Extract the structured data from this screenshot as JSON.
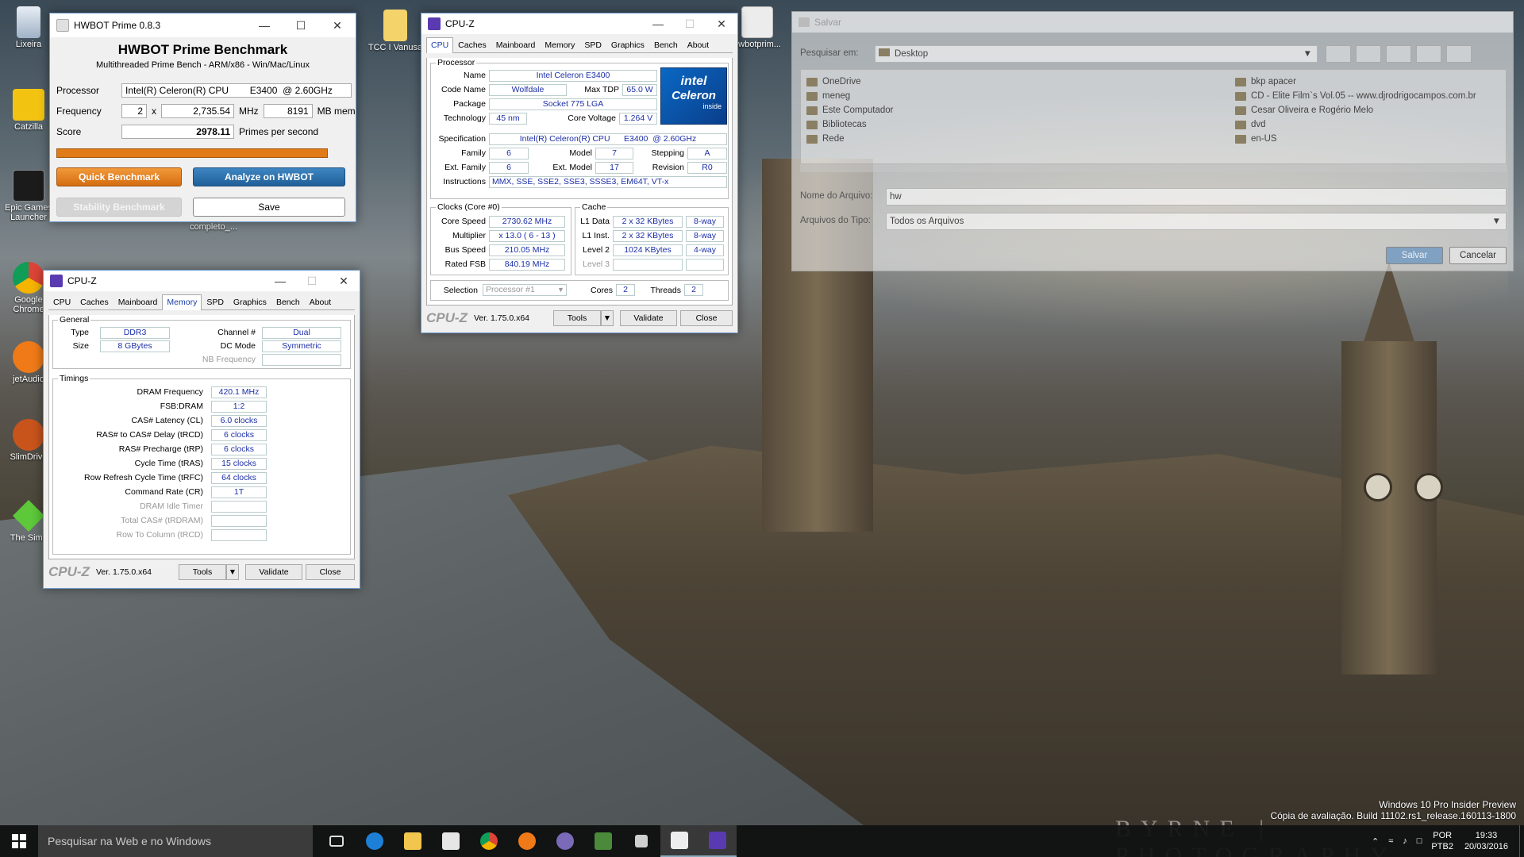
{
  "desktop_icons": [
    {
      "label": "Lixeira"
    },
    {
      "label": "Catzilla"
    },
    {
      "label": "Epic Games Launcher"
    },
    {
      "label": "Google Chrome"
    },
    {
      "label": "jetAudio"
    },
    {
      "label": "SlimDrive"
    },
    {
      "label": "The Sims"
    },
    {
      "label": "TCC I Vanusa"
    },
    {
      "label": "hwbotprim..."
    },
    {
      "label": "completo_..."
    }
  ],
  "wallpaper": {
    "watermark": "BYRNE | PHOTOGRAPHY",
    "build_line1": "Windows 10 Pro Insider Preview",
    "build_line2": "Cópia de avaliação. Build 11102.rs1_release.160113-1800"
  },
  "hwbot": {
    "title": "HWBOT Prime 0.8.3",
    "heading": "HWBOT Prime Benchmark",
    "subheading": "Multithreaded Prime Bench - ARM/x86 - Win/Mac/Linux",
    "processor_label": "Processor",
    "processor_value": "Intel(R) Celeron(R) CPU        E3400  @ 2.60GHz",
    "frequency_label": "Frequency",
    "freq_mult": "2",
    "freq_x": "x",
    "freq_mhz": "2,735.54",
    "freq_unit": "MHz",
    "mem_value": "8191",
    "mem_unit": "MB mem",
    "score_label": "Score",
    "score_value": "2978.11",
    "score_unit": "Primes per second",
    "btn_quick": "Quick Benchmark",
    "btn_analyze": "Analyze on HWBOT",
    "btn_stability": "Stability Benchmark",
    "btn_save": "Save",
    "progress": 1.0
  },
  "cpuz_cpu": {
    "title": "CPU-Z",
    "tabs": [
      "CPU",
      "Caches",
      "Mainboard",
      "Memory",
      "SPD",
      "Graphics",
      "Bench",
      "About"
    ],
    "processor_legend": "Processor",
    "name_label": "Name",
    "name": "Intel Celeron E3400",
    "codename_label": "Code Name",
    "codename": "Wolfdale",
    "maxtdp_label": "Max TDP",
    "maxtdp": "65.0 W",
    "package_label": "Package",
    "package": "Socket 775 LGA",
    "technology_label": "Technology",
    "technology": "45 nm",
    "corevoltage_label": "Core Voltage",
    "corevoltage": "1.264 V",
    "spec_label": "Specification",
    "spec": "Intel(R) Celeron(R) CPU      E3400  @ 2.60GHz",
    "family_label": "Family",
    "family": "6",
    "model_label": "Model",
    "model": "7",
    "stepping_label": "Stepping",
    "stepping": "A",
    "extfamily_label": "Ext. Family",
    "extfamily": "6",
    "extmodel_label": "Ext. Model",
    "extmodel": "17",
    "revision_label": "Revision",
    "revision": "R0",
    "instructions_label": "Instructions",
    "instructions": "MMX, SSE, SSE2, SSE3, SSSE3, EM64T, VT-x",
    "clocks_legend": "Clocks (Core #0)",
    "corespeed_label": "Core Speed",
    "corespeed": "2730.62 MHz",
    "multiplier_label": "Multiplier",
    "multiplier": "x 13.0 ( 6 - 13 )",
    "busspeed_label": "Bus Speed",
    "busspeed": "210.05 MHz",
    "ratedfsb_label": "Rated FSB",
    "ratedfsb": "840.19 MHz",
    "cache_legend": "Cache",
    "l1data_label": "L1 Data",
    "l1data": "2 x 32 KBytes",
    "l1data_way": "8-way",
    "l1inst_label": "L1 Inst.",
    "l1inst": "2 x 32 KBytes",
    "l1inst_way": "8-way",
    "level2_label": "Level 2",
    "level2": "1024 KBytes",
    "level2_way": "4-way",
    "level3_label": "Level 3",
    "selection_label": "Selection",
    "selection": "Processor #1",
    "cores_label": "Cores",
    "cores": "2",
    "threads_label": "Threads",
    "threads": "2",
    "logo_top": "intel",
    "logo_brand": "Celeron",
    "logo_bottom": "inside",
    "footer_logo": "CPU-Z",
    "version": "Ver. 1.75.0.x64",
    "btn_tools": "Tools",
    "btn_validate": "Validate",
    "btn_close": "Close"
  },
  "cpuz_mem": {
    "title": "CPU-Z",
    "tabs": [
      "CPU",
      "Caches",
      "Mainboard",
      "Memory",
      "SPD",
      "Graphics",
      "Bench",
      "About"
    ],
    "general_legend": "General",
    "type_label": "Type",
    "type": "DDR3",
    "channel_label": "Channel #",
    "channel": "Dual",
    "size_label": "Size",
    "size": "8 GBytes",
    "dcmode_label": "DC Mode",
    "dcmode": "Symmetric",
    "nbfreq_label": "NB Frequency",
    "timings_legend": "Timings",
    "timings": [
      {
        "label": "DRAM Frequency",
        "value": "420.1 MHz"
      },
      {
        "label": "FSB:DRAM",
        "value": "1:2"
      },
      {
        "label": "CAS# Latency (CL)",
        "value": "6.0 clocks"
      },
      {
        "label": "RAS# to CAS# Delay (tRCD)",
        "value": "6 clocks"
      },
      {
        "label": "RAS# Precharge (tRP)",
        "value": "6 clocks"
      },
      {
        "label": "Cycle Time (tRAS)",
        "value": "15 clocks"
      },
      {
        "label": "Row Refresh Cycle Time (tRFC)",
        "value": "64 clocks"
      },
      {
        "label": "Command Rate (CR)",
        "value": "1T"
      },
      {
        "label": "DRAM Idle Timer",
        "value": ""
      },
      {
        "label": "Total CAS# (tRDRAM)",
        "value": ""
      },
      {
        "label": "Row To Column (tRCD)",
        "value": ""
      }
    ],
    "footer_logo": "CPU-Z",
    "version": "Ver. 1.75.0.x64",
    "btn_tools": "Tools",
    "btn_validate": "Validate",
    "btn_close": "Close"
  },
  "save_dialog": {
    "title": "Salvar",
    "lookin_label": "Pesquisar em:",
    "lookin_value": "Desktop",
    "items_left": [
      "OneDrive",
      "meneg",
      "Este Computador",
      "Bibliotecas",
      "Rede"
    ],
    "items_right": [
      "bkp apacer",
      "CD - Elite Film`s Vol.05 -- www.djrodrigocampos.com.br",
      "Cesar Oliveira e Rogério Melo",
      "dvd",
      "en-US"
    ],
    "filename_label": "Nome do Arquivo:",
    "filename_value": "hw",
    "filetype_label": "Arquivos do Tipo:",
    "filetype_value": "Todos os Arquivos",
    "btn_save": "Salvar",
    "btn_cancel": "Cancelar"
  },
  "taskbar": {
    "search_placeholder": "Pesquisar na Web e no Windows",
    "lang1": "POR",
    "lang2": "PTB2",
    "time": "19:33",
    "date": "20/03/2016"
  }
}
